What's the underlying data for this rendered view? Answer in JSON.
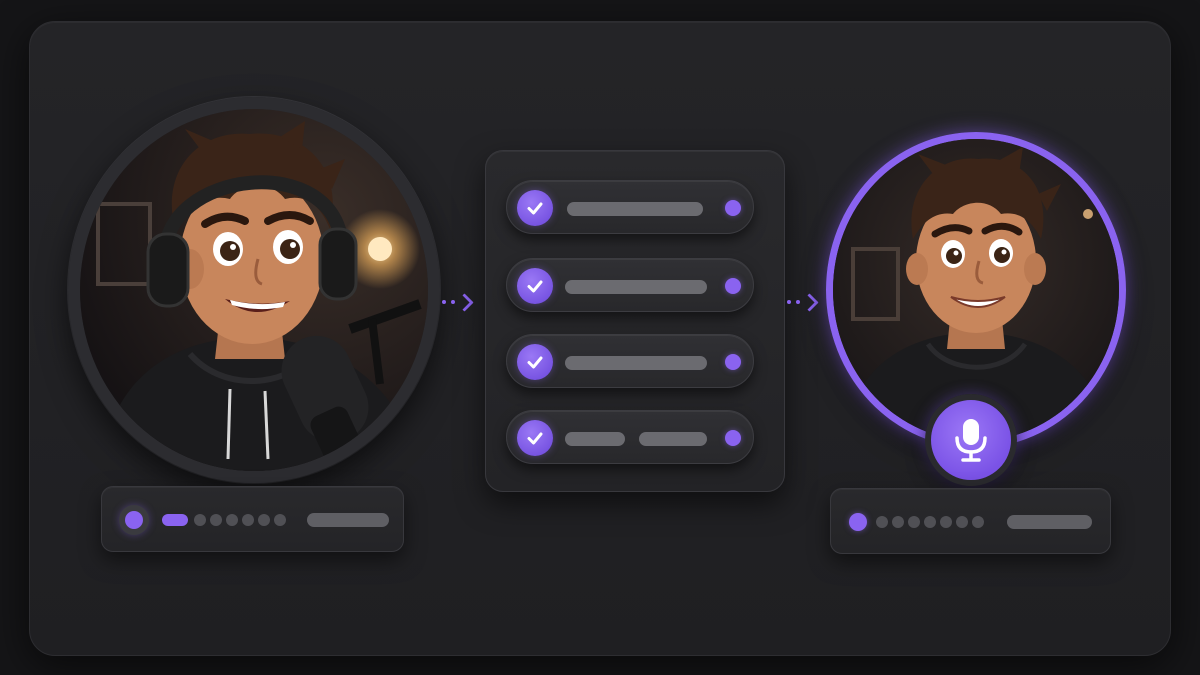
{
  "colors": {
    "accent": "#8a63f0",
    "background": "#151517",
    "panel": "#242427",
    "placeholder_bar": "#6b6b70"
  },
  "source_avatar": {
    "icon": "person-with-headphones-and-microphone"
  },
  "target_avatar": {
    "icon": "person-portrait",
    "mic_icon": "microphone-icon"
  },
  "checklist": {
    "items": [
      {
        "checked": true,
        "icon": "checkmark-icon"
      },
      {
        "checked": true,
        "icon": "checkmark-icon"
      },
      {
        "checked": true,
        "icon": "checkmark-icon"
      },
      {
        "checked": true,
        "icon": "checkmark-icon"
      }
    ]
  },
  "source_status": {
    "active_steps": 1,
    "total_steps": 7
  },
  "target_status": {
    "active_steps": 0,
    "total_steps": 7
  }
}
